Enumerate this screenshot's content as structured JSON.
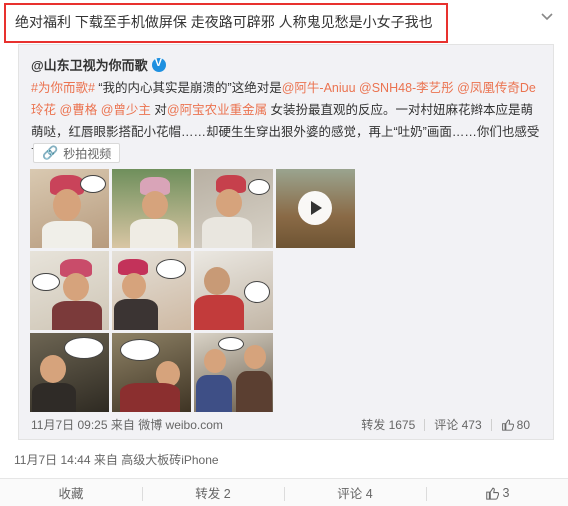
{
  "post": {
    "text": "绝对福利 下载至手机做屏保 走夜路可辟邪 人称鬼见愁是小女子我也",
    "timestamp": "11月7日 14:44",
    "source_prefix": "来自",
    "source": "高级大板砖iPhone"
  },
  "repost": {
    "author": "@山东卫视为你而歌",
    "text_parts": {
      "p1_tag": "#为你而歌#",
      "p2": " “我的内心其实是崩溃的”这绝对是",
      "m1": "@阿牛-Aniuu",
      "sp1": " ",
      "m2": "@SNH48-李艺彤",
      "sp2": " ",
      "m3": "@凤凰传奇De玲花",
      "sp3": " ",
      "m4": "@曹格",
      "sp4": " ",
      "m5": "@曾少主",
      "p3": " 对",
      "m6": "@阿宝农业重金属",
      "p4": " 女装扮最直观的反应。一对村妞麻花辫本应是萌萌哒，红唇眼影搭配小花帽……却硬生生穿出狠外婆的感觉，再上“吐奶”画面……你们也感受下　　？"
    },
    "video_link": "秒拍视频",
    "timestamp": "11月7日 09:25",
    "source_prefix": "来自",
    "source": "微博 weibo.com",
    "reposts": "转发 1675",
    "comments": "评论 473",
    "likes": "80"
  },
  "actions": {
    "favorite": "收藏",
    "repost": "转发 2",
    "comment": "评论 4",
    "like": "3"
  },
  "colors": {
    "highlight_border": "#e8312e",
    "link": "#eb7350",
    "verified": "#1e90e0"
  }
}
